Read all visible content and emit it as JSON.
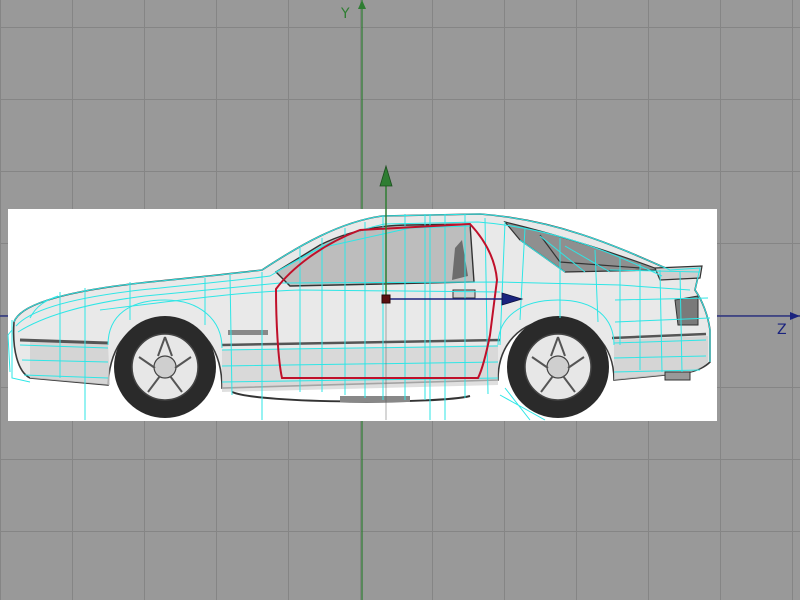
{
  "viewport": {
    "axis_labels": {
      "y": "Y",
      "z": "Z"
    },
    "colors": {
      "background": "#999999",
      "grid": "#858585",
      "y_axis": "#2e7d32",
      "z_axis": "#1a237e",
      "wireframe": "#2ee6e6",
      "door_outline": "#c0102a",
      "pivot": "#5a1010",
      "reference_image_bg": "#ffffff"
    },
    "icons": {
      "move_gizmo": "translate-arrows-icon",
      "pivot": "pivot-point-icon"
    }
  }
}
